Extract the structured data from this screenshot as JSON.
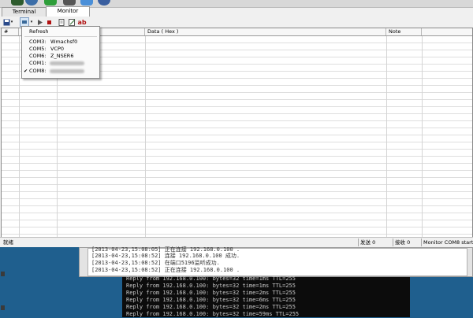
{
  "tabs": [
    {
      "label": "Terminal",
      "active": false
    },
    {
      "label": "Monitor",
      "active": true
    }
  ],
  "toolbar": {
    "text_button": "ab"
  },
  "grid": {
    "columns": [
      "#",
      "",
      "",
      "Data ( Hex )",
      "Note"
    ]
  },
  "menu": {
    "refresh": "Refresh",
    "items": [
      {
        "port": "COM3:",
        "desc": "Wmachsf0",
        "checked": false
      },
      {
        "port": "COM5:",
        "desc": "VCP0",
        "checked": false
      },
      {
        "port": "COM6:",
        "desc": "Z_NSER6",
        "checked": false
      },
      {
        "port": "COM1:",
        "desc": "",
        "checked": false
      },
      {
        "port": "COM8:",
        "desc": "",
        "checked": true
      }
    ]
  },
  "status": {
    "ready": "就绪",
    "sent": "发送 0",
    "received": "接收 0",
    "monitor": "Monitor COM8 starte"
  },
  "log": {
    "lines": [
      "[2013-04-23,15:08:05] 正在连接 192.168.0.100 .",
      "[2013-04-23,15:08:52] 连接 192.168.0.100 成功.",
      "[2013-04-23,15:08:52] 在端口5196监听成功.",
      "[2013-04-23,15:08:52] 正在连接 192.168.0.100 ."
    ]
  },
  "console": {
    "lines": [
      "Reply from 192.168.0.100: bytes=32 time=1ms TTL=255",
      "Reply from 192.168.0.100: bytes=32 time=1ms TTL=255",
      "Reply from 192.168.0.100: bytes=32 time=2ms TTL=255",
      "Reply from 192.168.0.100: bytes=32 time=6ms TTL=255",
      "Reply from 192.168.0.100: bytes=32 time=2ms TTL=255",
      "Reply from 192.168.0.100: bytes=32 time=59ms TTL=255"
    ]
  }
}
